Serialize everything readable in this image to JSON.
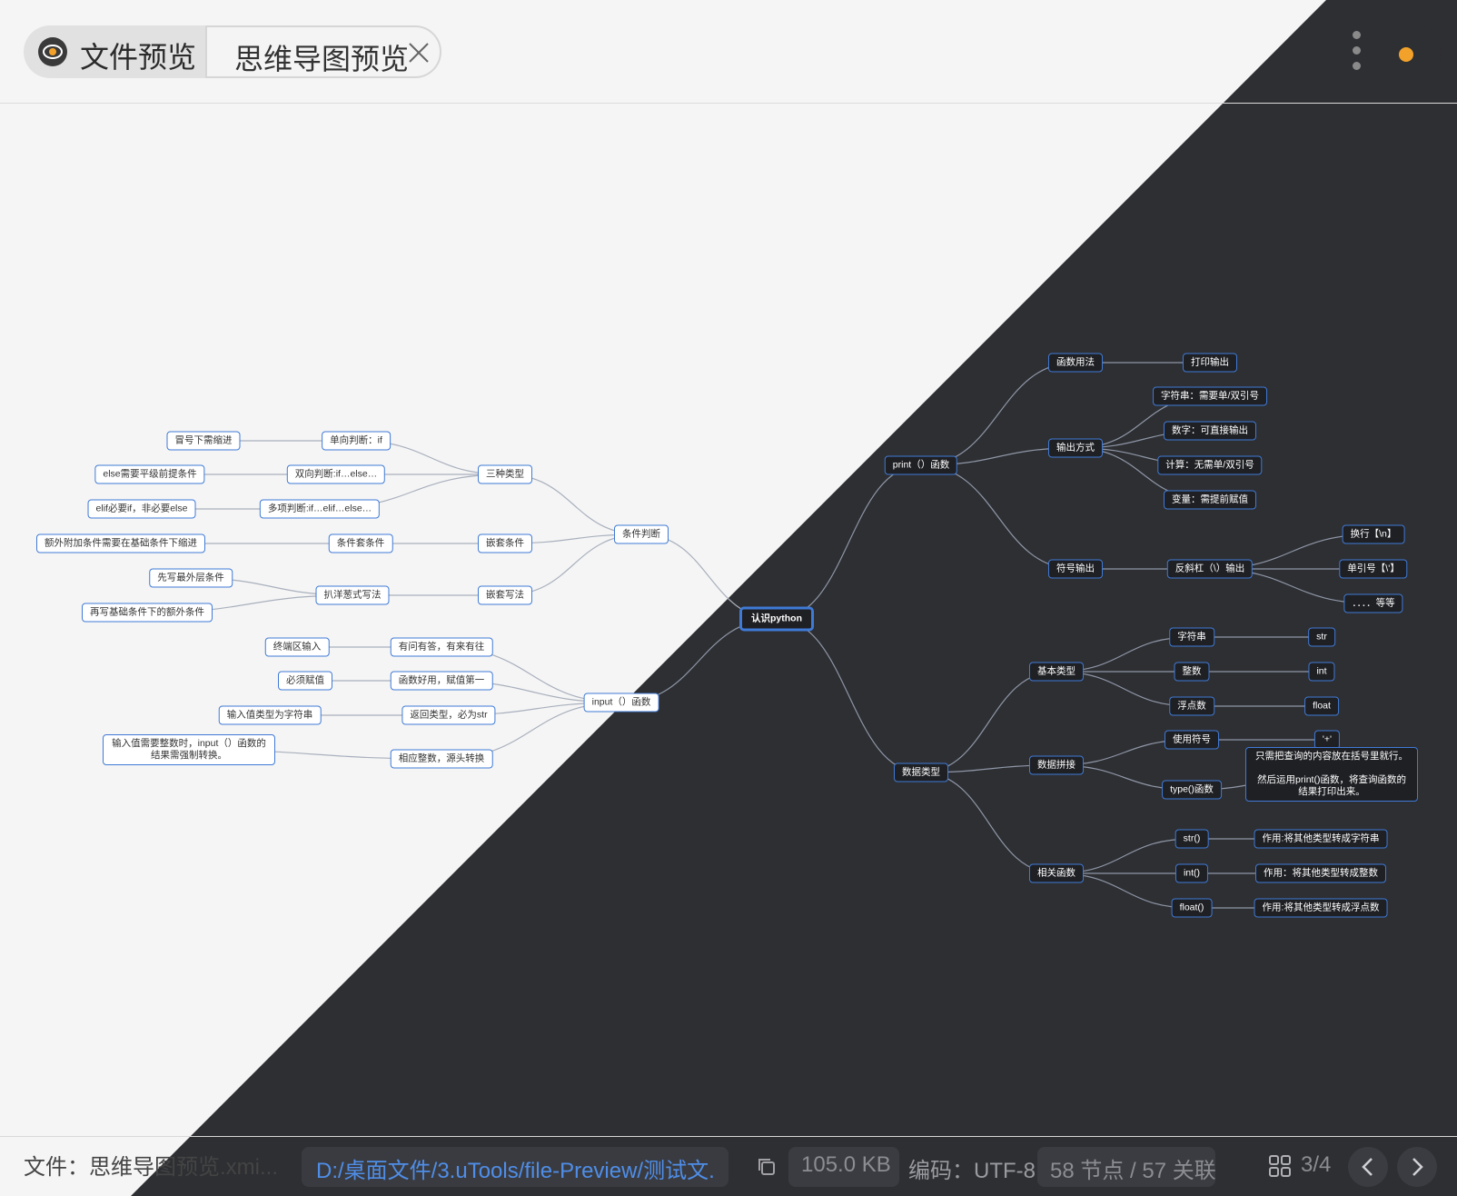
{
  "tabs": {
    "file_preview": "文件预览",
    "mindmap_preview": "思维导图预览"
  },
  "icons": {
    "eye": "eye-icon",
    "close": "close-icon",
    "more": "more-vertical-icon",
    "theme": "sun-icon",
    "copy": "copy-icon",
    "grid": "grid-icon",
    "prev": "chevron-left-icon",
    "next": "chevron-right-icon"
  },
  "colors": {
    "accent": "#3f7ad6",
    "light_bg": "#f5f5f5",
    "dark_bg": "#2e2f33",
    "path_link": "#4f8ee8",
    "sun": "#f2a22a"
  },
  "mindmap": {
    "root": "认识python",
    "nodes": [
      {
        "id": "root",
        "text": "认识python",
        "parent": null
      },
      {
        "id": "print",
        "text": "print（）函数",
        "parent": "root"
      },
      {
        "id": "dtype",
        "text": "数据类型",
        "parent": "root"
      },
      {
        "id": "cond",
        "text": "条件判断",
        "parent": "root"
      },
      {
        "id": "input",
        "text": "input（）函数",
        "parent": "root"
      },
      {
        "id": "usage",
        "text": "函数用法",
        "parent": "print"
      },
      {
        "id": "usage1",
        "text": "打印输出",
        "parent": "usage"
      },
      {
        "id": "outway",
        "text": "输出方式",
        "parent": "print"
      },
      {
        "id": "ow1",
        "text": "字符串：需要单/双引号",
        "parent": "outway"
      },
      {
        "id": "ow2",
        "text": "数字：可直接输出",
        "parent": "outway"
      },
      {
        "id": "ow3",
        "text": "计算：无需单/双引号",
        "parent": "outway"
      },
      {
        "id": "ow4",
        "text": "变量：需提前赋值",
        "parent": "outway"
      },
      {
        "id": "symout",
        "text": "符号输出",
        "parent": "print"
      },
      {
        "id": "backslash",
        "text": "反斜杠（\\）输出",
        "parent": "symout"
      },
      {
        "id": "bs1",
        "text": "换行【\\n】",
        "parent": "backslash"
      },
      {
        "id": "bs2",
        "text": "单引号【\\'】",
        "parent": "backslash"
      },
      {
        "id": "bs3",
        "text": "．．．．等等",
        "parent": "backslash"
      },
      {
        "id": "basic",
        "text": "基本类型",
        "parent": "dtype"
      },
      {
        "id": "b1",
        "text": "字符串",
        "parent": "basic"
      },
      {
        "id": "b1a",
        "text": "str",
        "parent": "b1"
      },
      {
        "id": "b2",
        "text": "整数",
        "parent": "basic"
      },
      {
        "id": "b2a",
        "text": "int",
        "parent": "b2"
      },
      {
        "id": "b3",
        "text": "浮点数",
        "parent": "basic"
      },
      {
        "id": "b3a",
        "text": "float",
        "parent": "b3"
      },
      {
        "id": "concat",
        "text": "数据拼接",
        "parent": "dtype"
      },
      {
        "id": "c1",
        "text": "使用符号",
        "parent": "concat"
      },
      {
        "id": "c1a",
        "text": "'+'",
        "parent": "c1"
      },
      {
        "id": "c2",
        "text": "type()函数",
        "parent": "concat"
      },
      {
        "id": "c2a",
        "text": "只需把查询的内容放在括号里就行。\n\n然后运用print()函数，将查询函数的结果打印出来。",
        "parent": "c2"
      },
      {
        "id": "related",
        "text": "相关函数",
        "parent": "dtype"
      },
      {
        "id": "r1",
        "text": "str()",
        "parent": "related"
      },
      {
        "id": "r1a",
        "text": "作用:将其他类型转成字符串",
        "parent": "r1"
      },
      {
        "id": "r2",
        "text": "int()",
        "parent": "related"
      },
      {
        "id": "r2a",
        "text": "作用：将其他类型转成整数",
        "parent": "r2"
      },
      {
        "id": "r3",
        "text": "float()",
        "parent": "related"
      },
      {
        "id": "r3a",
        "text": "作用:将其他类型转成浮点数",
        "parent": "r3"
      },
      {
        "id": "three",
        "text": "三种类型",
        "parent": "cond"
      },
      {
        "id": "t1",
        "text": "单向判断：if",
        "parent": "three"
      },
      {
        "id": "t1a",
        "text": "冒号下需缩进",
        "parent": "t1"
      },
      {
        "id": "t2",
        "text": "双向判断:if…else…",
        "parent": "three"
      },
      {
        "id": "t2a",
        "text": "else需要平级前提条件",
        "parent": "t2"
      },
      {
        "id": "t3",
        "text": "多项判断:if…elif…else…",
        "parent": "three"
      },
      {
        "id": "t3a",
        "text": "elif必要if，非必要else",
        "parent": "t3"
      },
      {
        "id": "nest",
        "text": "嵌套条件",
        "parent": "cond"
      },
      {
        "id": "n1",
        "text": "条件套条件",
        "parent": "nest"
      },
      {
        "id": "n1a",
        "text": "额外附加条件需要在基础条件下缩进",
        "parent": "n1"
      },
      {
        "id": "nestw",
        "text": "嵌套写法",
        "parent": "cond"
      },
      {
        "id": "nw1",
        "text": "扒洋葱式写法",
        "parent": "nestw"
      },
      {
        "id": "nw1a",
        "text": "先写最外层条件",
        "parent": "nw1"
      },
      {
        "id": "nw1b",
        "text": "再写基础条件下的额外条件",
        "parent": "nw1"
      },
      {
        "id": "i1",
        "text": "有问有答，有来有往",
        "parent": "input"
      },
      {
        "id": "i1a",
        "text": "终端区输入",
        "parent": "i1"
      },
      {
        "id": "i2",
        "text": "函数好用，赋值第一",
        "parent": "input"
      },
      {
        "id": "i2a",
        "text": "必须赋值",
        "parent": "i2"
      },
      {
        "id": "i3",
        "text": "返回类型，必为str",
        "parent": "input"
      },
      {
        "id": "i3a",
        "text": "输入值类型为字符串",
        "parent": "i3"
      },
      {
        "id": "i4",
        "text": "相应整数，源头转换",
        "parent": "input"
      },
      {
        "id": "i4a",
        "text": "输入值需要整数时，input（）函数的结果需强制转换。",
        "parent": "i4"
      }
    ]
  },
  "footer": {
    "file_label": "文件：思维导图预览.xmi...",
    "path": "D:/桌面文件/3.uTools/file-Preview/测试文...",
    "size": "105.0 KB",
    "encoding": "编码：UTF-8",
    "stats": "58 节点 / 57 关联",
    "page": "3/4"
  }
}
